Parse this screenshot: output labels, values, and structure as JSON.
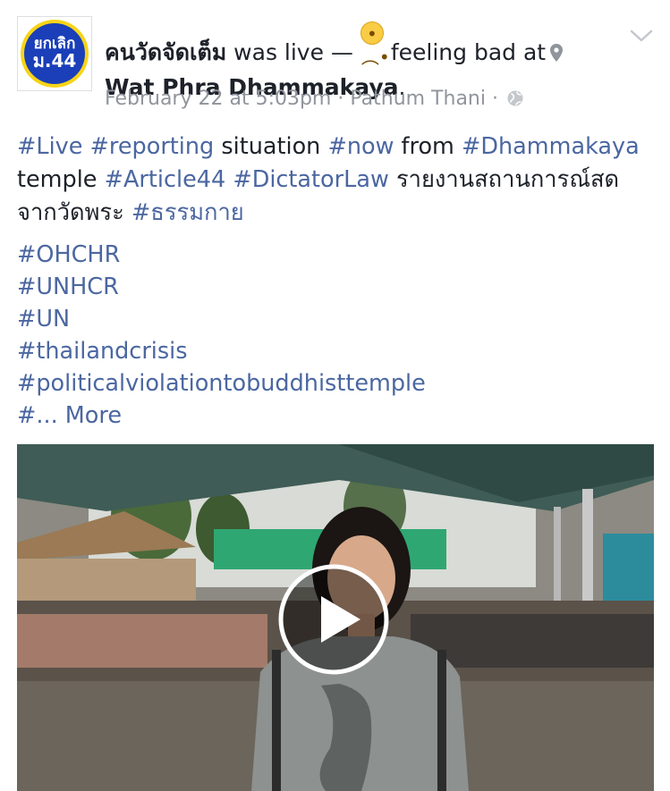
{
  "avatar": {
    "line1": "ยกเลิก",
    "line2": "ม.44"
  },
  "header": {
    "page_name": "คนวัดจัดเต็ม",
    "action": " was live — ",
    "feeling": " feeling bad at",
    "place_name": "Wat Phra Dhammakaya",
    "place_suffix": ".",
    "emoji_icon": "disappointed-face-icon",
    "location_icon": "map-pin-icon"
  },
  "meta": {
    "timestamp": "February 22 at 5:03pm",
    "separator1": " · ",
    "location": "Pathum Thani",
    "separator2": " · ",
    "audience_icon": "globe-icon"
  },
  "body": {
    "tag_live": "#Live",
    "tag_reporting": "#reporting",
    "text_situation": " situation ",
    "tag_now": "#now",
    "text_from": " from ",
    "tag_dhammakaya": "#Dhammakaya",
    "text_temple": "temple ",
    "tag_article44": "#Article44",
    "tag_dictatorlaw": "#DictatorLaw",
    "text_thai": " รายงานสถานการณ์สด จากวัดพระ ",
    "tag_thai": "#ธรรมกาย"
  },
  "tags": [
    "#OHCHR",
    "#UNHCR",
    "#UN",
    "#thailandcrisis",
    "#politicalviolationtobuddhisttemple"
  ],
  "more": {
    "prefix": "#... ",
    "label": "More"
  },
  "video": {
    "play_icon": "play-icon"
  },
  "colors": {
    "link": "#4b67a1",
    "meta": "#90949c",
    "text": "#1d2129",
    "avatar_blue": "#1a3fb8",
    "avatar_ring": "#f7d417"
  }
}
